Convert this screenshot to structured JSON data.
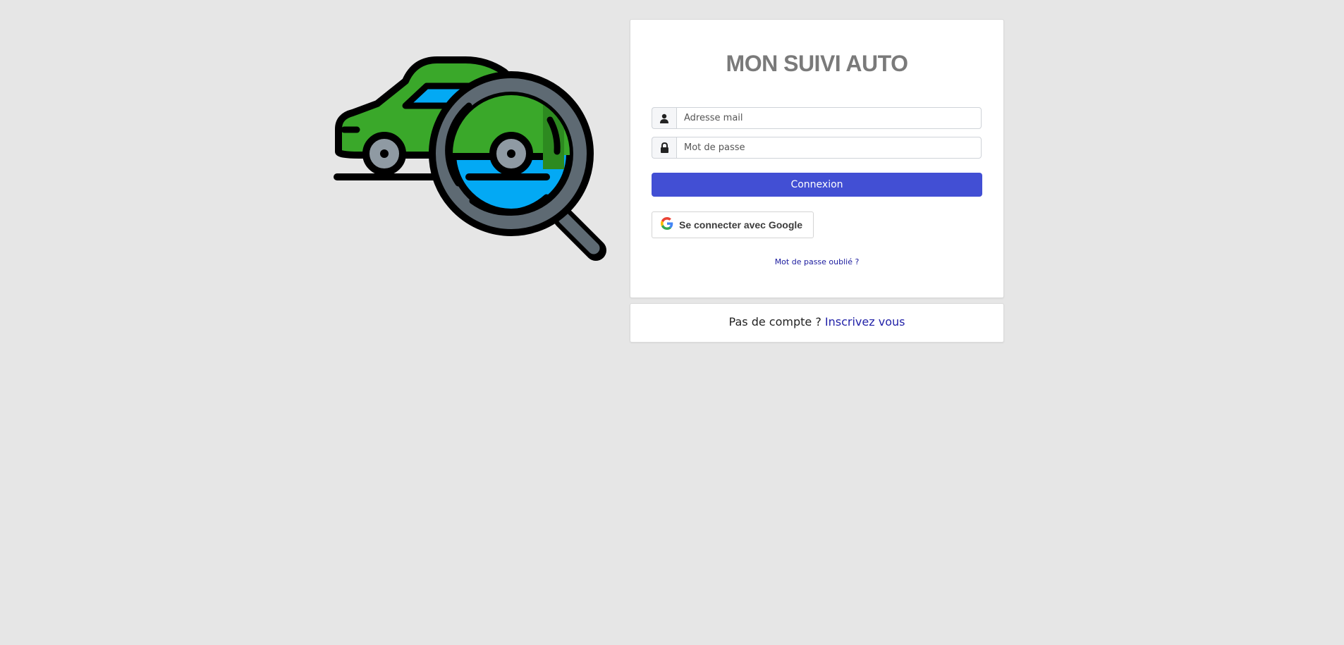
{
  "app": {
    "title": "MON SUIVI AUTO"
  },
  "login": {
    "email_placeholder": "Adresse mail",
    "password_placeholder": "Mot de passe",
    "submit_label": "Connexion",
    "google_label": "Se connecter avec Google",
    "forgot_label": "Mot de passe oublié ?"
  },
  "signup": {
    "prompt": "Pas de compte ? ",
    "link_label": "Inscrivez vous"
  },
  "icons": {
    "logo": "car-magnifier-icon",
    "email": "user-icon",
    "password": "lock-icon",
    "google": "google-g-icon"
  },
  "colors": {
    "background": "#e6e6e6",
    "primary": "#424fd4",
    "title": "#7a7a7a",
    "link": "#2222a8",
    "car_green": "#3aa82a",
    "glass_blue": "#03a9f4"
  }
}
